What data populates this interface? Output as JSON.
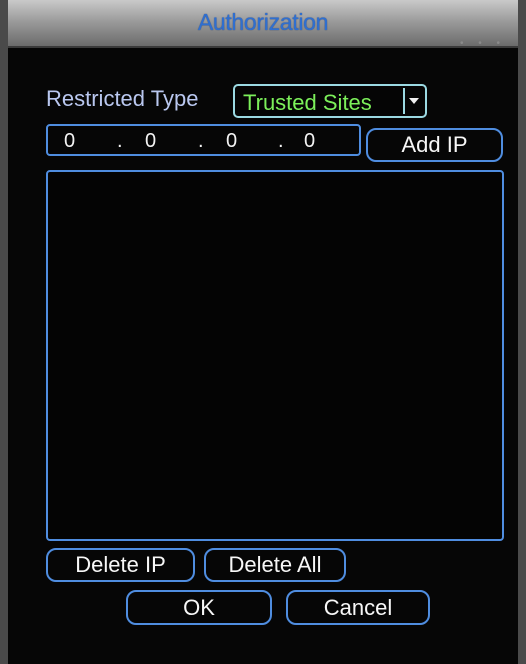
{
  "window": {
    "title": "Authorization"
  },
  "form": {
    "restricted_type_label": "Restricted Type",
    "restricted_type_value": "Trusted Sites",
    "ip": {
      "octet1": "0",
      "octet2": "0",
      "octet3": "0",
      "octet4": "0"
    }
  },
  "buttons": {
    "add_ip": "Add IP",
    "delete_ip": "Delete IP",
    "delete_all": "Delete All",
    "ok": "OK",
    "cancel": "Cancel"
  },
  "list": {
    "ips": []
  },
  "colors": {
    "background": "#060606",
    "title_text": "#2f6fd0",
    "field_border": "#4f8de0",
    "select_value": "#7cf05a",
    "label_text": "#b9c7ef"
  }
}
